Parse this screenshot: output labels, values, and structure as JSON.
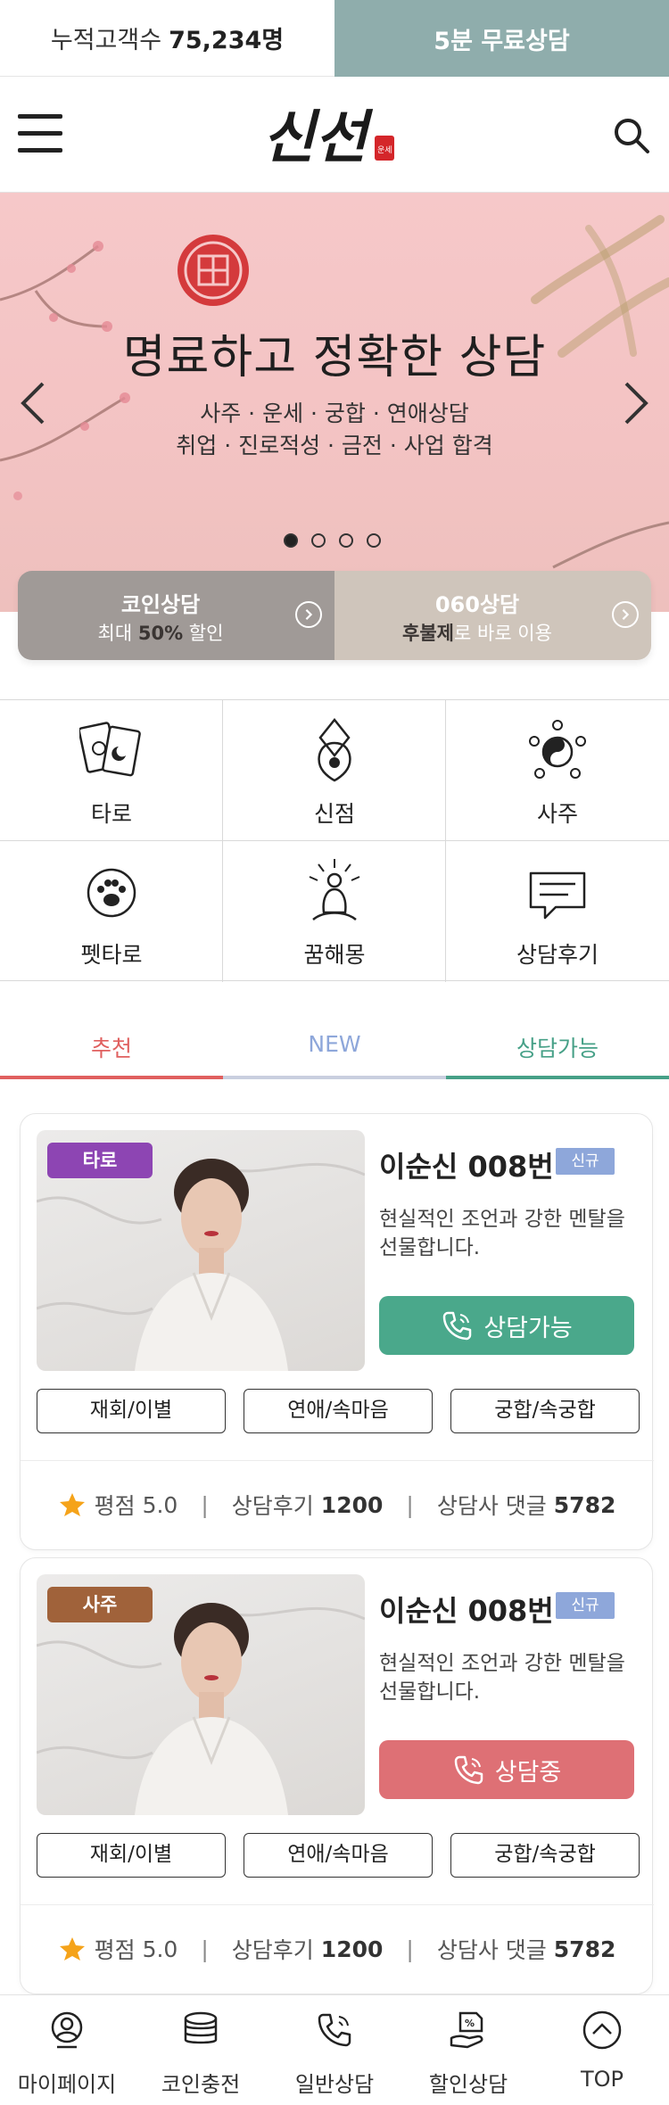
{
  "topbar": {
    "count_label": "누적고객수",
    "count_value": "75,234명",
    "free_consult": "5분 무료상담"
  },
  "header": {
    "logo_text": "신선",
    "logo_seal": "운세"
  },
  "banner": {
    "title": "명료하고 정확한 상담",
    "line1": "사주 · 운세 · 궁합 · 연애상담",
    "line2": "취업 · 진로적성 · 금전 · 사업 합격",
    "slide_index": 1,
    "slide_count": 4
  },
  "coin": {
    "left_title": "코인상담",
    "left_sub_pre": "최대 ",
    "left_sub_bold": "50%",
    "left_sub_post": " 할인",
    "right_title": "060상담",
    "right_sub_bold": "후불제",
    "right_sub_post": "로 바로 이용"
  },
  "categories": [
    {
      "label": "타로",
      "icon": "tarot-cards-icon"
    },
    {
      "label": "신점",
      "icon": "shaman-knot-icon"
    },
    {
      "label": "사주",
      "icon": "yin-yang-icon"
    },
    {
      "label": "펫타로",
      "icon": "paw-icon"
    },
    {
      "label": "꿈해몽",
      "icon": "meditation-icon"
    },
    {
      "label": "상담후기",
      "icon": "chat-bubble-icon"
    }
  ],
  "tabs": [
    {
      "label": "추천",
      "color": "#e0605f"
    },
    {
      "label": "NEW",
      "color": "#8ea7da"
    },
    {
      "label": "상담가능",
      "color": "#46a087"
    }
  ],
  "counselors": [
    {
      "category": "타로",
      "category_color": "#8d45b3",
      "name": "이순신 008번",
      "tag": "신규",
      "desc": "현실적인 조언과 강한 멘탈을 선물합니다.",
      "status": "상담가능",
      "status_color": "#4aa88b",
      "keywords": [
        "재회/이별",
        "연애/속마음",
        "궁합/속궁합"
      ],
      "rating_label": "평점",
      "rating": "5.0",
      "review_label": "상담후기",
      "review_count": "1200",
      "comment_label": "상담사 댓글",
      "comment_count": "5782"
    },
    {
      "category": "사주",
      "category_color": "#a0623a",
      "name": "이순신 008번",
      "tag": "신규",
      "desc": "현실적인 조언과 강한 멘탈을 선물합니다.",
      "status": "상담중",
      "status_color": "#de7075",
      "keywords": [
        "재회/이별",
        "연애/속마음",
        "궁합/속궁합"
      ],
      "rating_label": "평점",
      "rating": "5.0",
      "review_label": "상담후기",
      "review_count": "1200",
      "comment_label": "상담사 댓글",
      "comment_count": "5782"
    }
  ],
  "bottom_nav": [
    {
      "label": "마이페이지",
      "icon": "user-icon"
    },
    {
      "label": "코인충전",
      "icon": "coins-icon"
    },
    {
      "label": "일반상담",
      "icon": "phone-icon"
    },
    {
      "label": "할인상담",
      "icon": "discount-hand-icon"
    },
    {
      "label": "TOP",
      "icon": "arrow-up-circle-icon"
    }
  ]
}
